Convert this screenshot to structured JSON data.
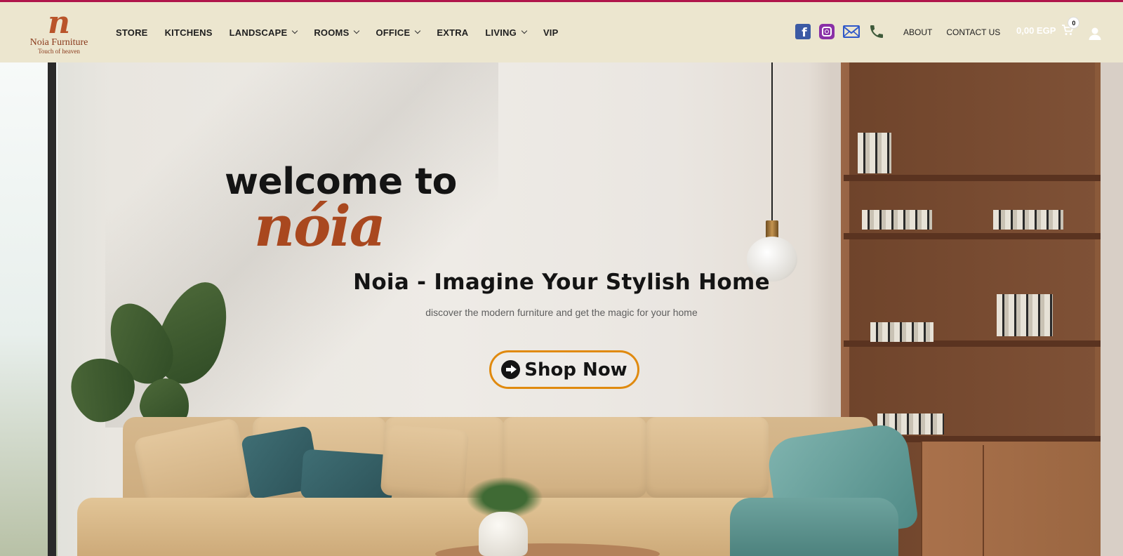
{
  "brand": {
    "mark": "n",
    "name": "Noia Furniture",
    "tagline": "Touch of heaven",
    "accent_color": "#b0154b",
    "logo_color": "#b9542a"
  },
  "nav": {
    "items": [
      {
        "label": "STORE",
        "has_dropdown": false
      },
      {
        "label": "KITCHENS",
        "has_dropdown": false
      },
      {
        "label": "LANDSCAPE",
        "has_dropdown": true
      },
      {
        "label": "ROOMS",
        "has_dropdown": true
      },
      {
        "label": "OFFICE",
        "has_dropdown": true
      },
      {
        "label": "EXTRA",
        "has_dropdown": false
      },
      {
        "label": "LIVING",
        "has_dropdown": true
      },
      {
        "label": "VIP",
        "has_dropdown": false
      }
    ],
    "social_icons": [
      "facebook-icon",
      "instagram-icon",
      "mail-icon",
      "phone-icon"
    ],
    "links": {
      "about": "ABOUT",
      "contact": "CONTACT US"
    },
    "cart": {
      "total": "0,00 EGP",
      "count": "0"
    },
    "account_icon": "user-icon",
    "background": "#ece6cf"
  },
  "hero": {
    "welcome_line": "welcome to",
    "brand_word": "nóia",
    "headline": "Noia - Imagine Your Stylish Home",
    "subline": "discover the modern furniture and get the magic for your home",
    "cta_label": "Shop Now",
    "cta_border_color": "#e08a0f",
    "brand_word_color": "#a9481f"
  }
}
